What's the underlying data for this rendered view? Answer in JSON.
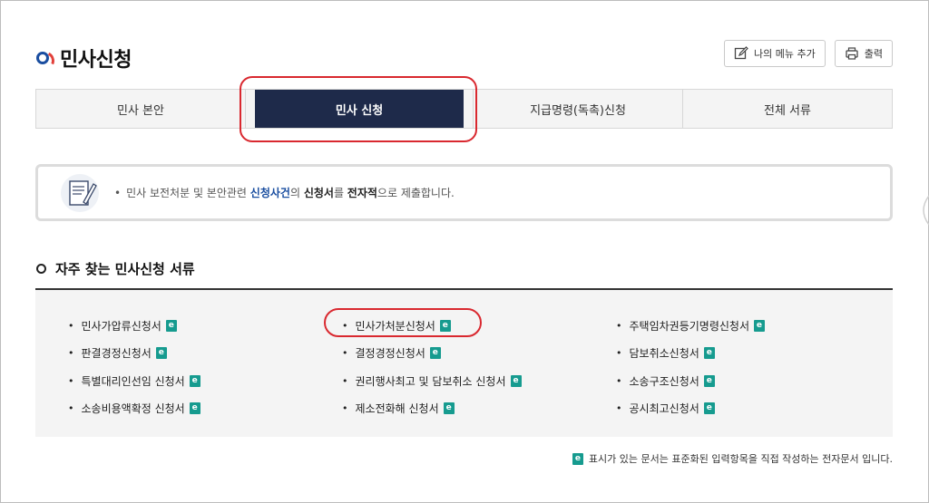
{
  "header": {
    "title": "민사신청",
    "add_menu_label": "나의 메뉴 추가",
    "print_label": "출력"
  },
  "tabs": [
    {
      "label": "민사 본안"
    },
    {
      "label": "민사 신청"
    },
    {
      "label": "지급명령(독촉)신청"
    },
    {
      "label": "전체 서류"
    }
  ],
  "notice": {
    "bullet": "•",
    "part1": "민사 보전처분 및 본안관련 ",
    "highlight1": "신청사건",
    "part2": "의 ",
    "highlight2": "신청서",
    "part3": "를 ",
    "highlight3": "전자적",
    "part4": "으로 제출합니다."
  },
  "section": {
    "title": "자주 찾는 민사신청 서류"
  },
  "documents": {
    "col1": [
      "민사가압류신청서",
      "판결경정신청서",
      "특별대리인선임 신청서",
      "소송비용액확정 신청서"
    ],
    "col2": [
      "민사가처분신청서",
      "결정경정신청서",
      "권리행사최고 및 담보취소 신청서",
      "제소전화해 신청서"
    ],
    "col3": [
      "주택임차권등기명령신청서",
      "담보취소신청서",
      "소송구조신청서",
      "공시최고신청서"
    ],
    "bullet": "•",
    "e_icon": "e"
  },
  "footer": {
    "note": "표시가 있는 문서는 표준화된 입력항목을 직접 작성하는 전자문서 입니다."
  },
  "colors": {
    "active_tab": "#1e2a4a",
    "accent_blue": "#1a4ea0",
    "annotation_red": "#d9282f",
    "e_icon": "#169b8f"
  }
}
